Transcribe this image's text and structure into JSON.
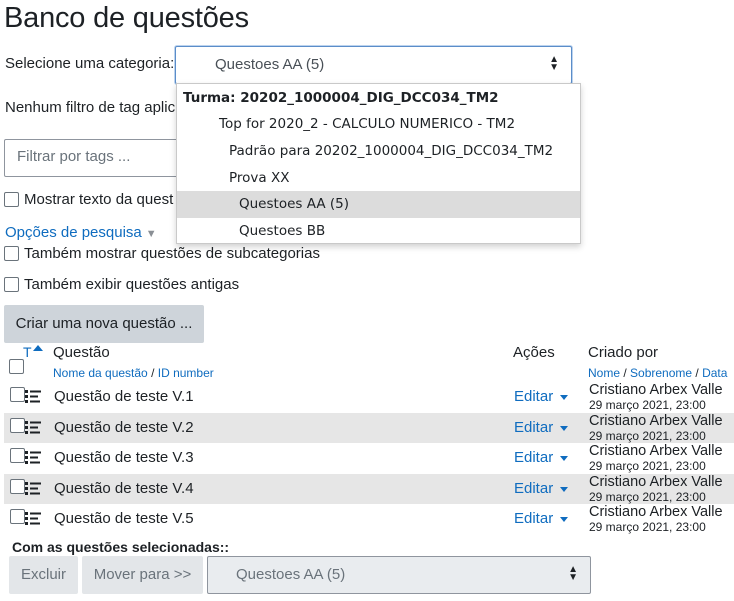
{
  "page": {
    "title": "Banco de questões"
  },
  "category": {
    "label": "Selecione uma categoria:",
    "selected": "Questoes AA (5)"
  },
  "tags": {
    "status_text": "Nenhum filtro de tag aplic",
    "filter_placeholder": "Filtrar por tags ..."
  },
  "options": {
    "show_question_text": "Mostrar texto da quest",
    "search_options_link": "Opções de pesquisa",
    "also_subcategories": "Também mostrar questões de subcategorias",
    "also_old": "Também exibir questões antigas"
  },
  "create_button": "Criar uma nova questão ...",
  "table": {
    "sort_T": "T",
    "col_question": "Questão",
    "col_question_sub1": "Nome da questão",
    "col_question_sub_sep": " / ",
    "col_question_sub2": "ID number",
    "col_actions": "Ações",
    "col_created": "Criado por",
    "col_created_sub1": "Nome",
    "col_created_sub2": "Sobrenome",
    "col_created_sub3": "Data",
    "col_created_sep": " / ",
    "rows": [
      {
        "name": "Questão de teste V.1",
        "action": "Editar",
        "creator": "Cristiano Arbex Valle",
        "date": "29 março 2021, 23:00"
      },
      {
        "name": "Questão de teste V.2",
        "action": "Editar",
        "creator": "Cristiano Arbex Valle",
        "date": "29 março 2021, 23:00"
      },
      {
        "name": "Questão de teste V.3",
        "action": "Editar",
        "creator": "Cristiano Arbex Valle",
        "date": "29 março 2021, 23:00"
      },
      {
        "name": "Questão de teste V.4",
        "action": "Editar",
        "creator": "Cristiano Arbex Valle",
        "date": "29 março 2021, 23:00"
      },
      {
        "name": "Questão de teste V.5",
        "action": "Editar",
        "creator": "Cristiano Arbex Valle",
        "date": "29 março 2021, 23:00"
      }
    ]
  },
  "bulk": {
    "label": "Com as questões selecionadas::",
    "delete": "Excluir",
    "move": "Mover para >>",
    "move_target": "Questoes AA (5)"
  },
  "dropdown": {
    "items": [
      {
        "label": "Turma: 20202_1000004_DIG_DCC034_TM2",
        "type": "group"
      },
      {
        "label": "Top for 2020_2 - CALCULO NUMERICO - TM2",
        "type": "item"
      },
      {
        "label": "Padrão para 20202_1000004_DIG_DCC034_TM2",
        "type": "item"
      },
      {
        "label": "Prova XX",
        "type": "item"
      },
      {
        "label": "Questoes AA (5)",
        "type": "selected"
      },
      {
        "label": "Questoes BB",
        "type": "item"
      }
    ]
  },
  "icons": {
    "question_type": "multiple-choice-icon",
    "select_caret": "updown-caret-icon",
    "sort": "sort-asc-icon"
  },
  "colors": {
    "link": "#0f6cbf",
    "button_bg": "#ced4da",
    "row_alt": "#e6e6e6",
    "dropdown_selected": "#dcdcdc"
  }
}
